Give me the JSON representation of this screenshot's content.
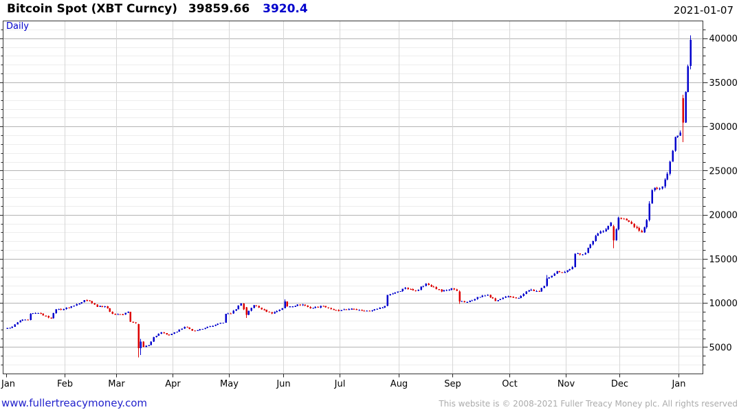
{
  "header": {
    "instrument": "Bitcoin Spot (XBT Curncy)",
    "last_price": "39859.66",
    "change": "3920.4",
    "date": "2021-01-07"
  },
  "chart": {
    "interval_label": "Daily"
  },
  "footer": {
    "website": "www.fullertreacymoney.com",
    "copyright": "This website is © 2008-2021 Fuller Treacy Money plc. All rights reserved"
  },
  "colors": {
    "up": "#0000cc",
    "down": "#dd0000",
    "accent_blue": "#0000cc",
    "link_blue": "#2222cc",
    "copyright_gray": "#ababab",
    "grid_minor": "#ededed",
    "grid_major": "#b3b3b3",
    "grid_month": "#d6d6d6",
    "border": "#333333",
    "tick": "#222222"
  },
  "chart_data": {
    "type": "candlestick",
    "title": "Bitcoin Spot (XBT Curncy)",
    "interval": "Daily",
    "sessions": "weekdays",
    "date_range": [
      "2020-01-01",
      "2021-01-07"
    ],
    "last_close": 39859.66,
    "change": 3920.4,
    "first_open": 7180,
    "ylim": [
      2000,
      42000
    ],
    "y_minor_step": 1000,
    "y_major_step": 5000,
    "y_axis_labels": [
      "5000",
      "10000",
      "15000",
      "20000",
      "25000",
      "30000",
      "35000",
      "40000"
    ],
    "x_month_labels": [
      "Jan",
      "Feb",
      "Mar",
      "Apr",
      "May",
      "Jun",
      "Jul",
      "Aug",
      "Sep",
      "Oct",
      "Nov",
      "Dec",
      "Jan"
    ],
    "up_color": "#0000cc",
    "down_color": "#dd0000",
    "close_anchors": [
      [
        "2020-01-01",
        7200
      ],
      [
        "2020-01-03",
        7350
      ],
      [
        "2020-01-08",
        8050
      ],
      [
        "2020-01-13",
        8100
      ],
      [
        "2020-01-14",
        8820
      ],
      [
        "2020-01-17",
        8900
      ],
      [
        "2020-01-24",
        8300
      ],
      [
        "2020-01-28",
        9300
      ],
      [
        "2020-01-31",
        9350
      ],
      [
        "2020-02-06",
        9750
      ],
      [
        "2020-02-12",
        10350
      ],
      [
        "2020-02-14",
        10250
      ],
      [
        "2020-02-19",
        9600
      ],
      [
        "2020-02-24",
        9670
      ],
      [
        "2020-02-27",
        8800
      ],
      [
        "2020-03-04",
        8750
      ],
      [
        "2020-03-06",
        9050
      ],
      [
        "2020-03-09",
        7900
      ],
      [
        "2020-03-11",
        7750
      ],
      [
        "2020-03-12",
        4900
      ],
      [
        "2020-03-13",
        5650
      ],
      [
        "2020-03-16",
        5050
      ],
      [
        "2020-03-18",
        5250
      ],
      [
        "2020-03-20",
        6150
      ],
      [
        "2020-03-25",
        6700
      ],
      [
        "2020-03-30",
        6400
      ],
      [
        "2020-04-02",
        6800
      ],
      [
        "2020-04-07",
        7350
      ],
      [
        "2020-04-10",
        6900
      ],
      [
        "2020-04-16",
        7100
      ],
      [
        "2020-04-23",
        7550
      ],
      [
        "2020-04-28",
        7800
      ],
      [
        "2020-04-29",
        8800
      ],
      [
        "2020-05-01",
        8850
      ],
      [
        "2020-05-07",
        9980
      ],
      [
        "2020-05-11",
        8700
      ],
      [
        "2020-05-14",
        9800
      ],
      [
        "2020-05-21",
        9050
      ],
      [
        "2020-05-25",
        8850
      ],
      [
        "2020-05-29",
        9450
      ],
      [
        "2020-06-01",
        10200
      ],
      [
        "2020-06-02",
        9650
      ],
      [
        "2020-06-10",
        9870
      ],
      [
        "2020-06-15",
        9450
      ],
      [
        "2020-06-22",
        9700
      ],
      [
        "2020-06-26",
        9250
      ],
      [
        "2020-06-30",
        9140
      ],
      [
        "2020-07-06",
        9350
      ],
      [
        "2020-07-10",
        9250
      ],
      [
        "2020-07-16",
        9130
      ],
      [
        "2020-07-22",
        9520
      ],
      [
        "2020-07-24",
        9700
      ],
      [
        "2020-07-27",
        10950
      ],
      [
        "2020-07-31",
        11350
      ],
      [
        "2020-08-05",
        11750
      ],
      [
        "2020-08-11",
        11400
      ],
      [
        "2020-08-17",
        12250
      ],
      [
        "2020-08-20",
        11850
      ],
      [
        "2020-08-25",
        11350
      ],
      [
        "2020-08-31",
        11680
      ],
      [
        "2020-09-02",
        11400
      ],
      [
        "2020-09-03",
        10200
      ],
      [
        "2020-09-08",
        10150
      ],
      [
        "2020-09-14",
        10700
      ],
      [
        "2020-09-18",
        10950
      ],
      [
        "2020-09-23",
        10250
      ],
      [
        "2020-09-30",
        10780
      ],
      [
        "2020-10-06",
        10600
      ],
      [
        "2020-10-12",
        11500
      ],
      [
        "2020-10-16",
        11350
      ],
      [
        "2020-10-20",
        11950
      ],
      [
        "2020-10-21",
        12800
      ],
      [
        "2020-10-27",
        13650
      ],
      [
        "2020-10-30",
        13550
      ],
      [
        "2020-11-04",
        14100
      ],
      [
        "2020-11-05",
        15600
      ],
      [
        "2020-11-11",
        15700
      ],
      [
        "2020-11-17",
        17650
      ],
      [
        "2020-11-23",
        18400
      ],
      [
        "2020-11-25",
        19150
      ],
      [
        "2020-11-26",
        17150
      ],
      [
        "2020-11-30",
        19700
      ],
      [
        "2020-12-03",
        19400
      ],
      [
        "2020-12-09",
        18550
      ],
      [
        "2020-12-11",
        18050
      ],
      [
        "2020-12-15",
        19450
      ],
      [
        "2020-12-16",
        21300
      ],
      [
        "2020-12-17",
        22800
      ],
      [
        "2020-12-18",
        23100
      ],
      [
        "2020-12-23",
        23250
      ],
      [
        "2020-12-25",
        24700
      ],
      [
        "2020-12-30",
        28850
      ],
      [
        "2020-12-31",
        29000
      ],
      [
        "2021-01-01",
        29350
      ],
      [
        "2021-01-04",
        30500
      ],
      [
        "2021-01-05",
        33950
      ],
      [
        "2021-01-06",
        36850
      ],
      [
        "2021-01-07",
        39859.66
      ]
    ],
    "ohlc_overrides": {
      "2020-03-12": [
        7650,
        7680,
        3850,
        4900
      ],
      "2020-03-13": [
        4900,
        5980,
        4150,
        5650
      ],
      "2020-05-11": [
        9550,
        9580,
        8350,
        8700
      ],
      "2020-06-01": [
        9450,
        10430,
        9430,
        10200
      ],
      "2020-09-03": [
        11350,
        11450,
        9950,
        10200
      ],
      "2020-10-21": [
        11950,
        13220,
        11900,
        12800
      ],
      "2020-11-26": [
        18750,
        18900,
        16250,
        17150
      ],
      "2020-12-16": [
        19450,
        21560,
        19280,
        21300
      ],
      "2021-01-04": [
        33250,
        33650,
        28250,
        30500
      ],
      "2021-01-07": [
        36900,
        40365,
        36520,
        39859.66
      ]
    }
  }
}
